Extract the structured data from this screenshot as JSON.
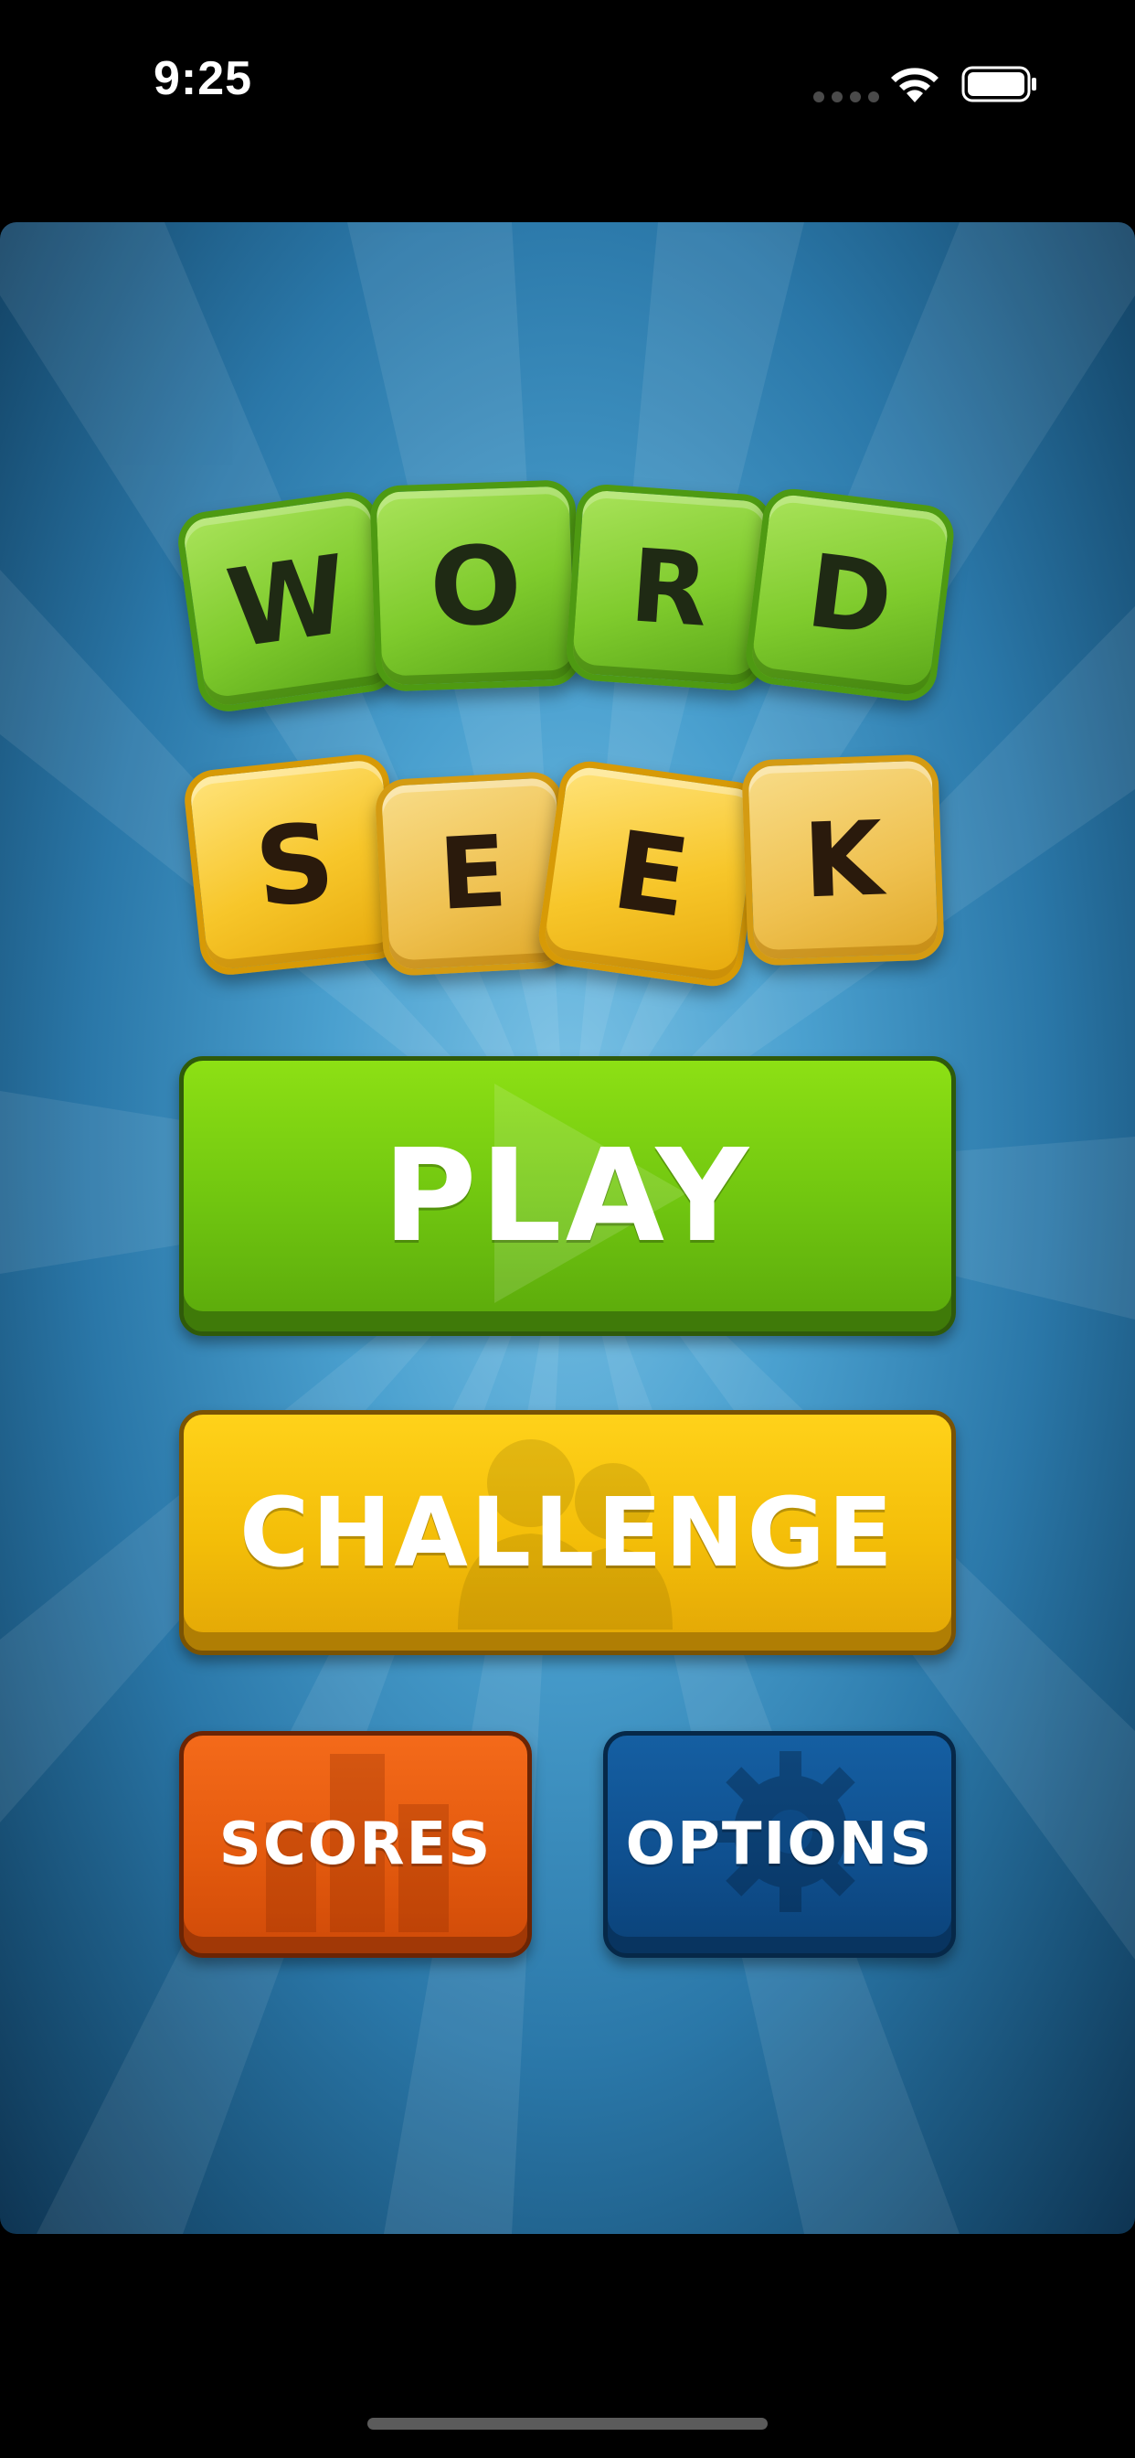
{
  "status_bar": {
    "time": "9:25",
    "icons": [
      "cellular-dots-icon",
      "wifi-icon",
      "battery-icon"
    ]
  },
  "logo": {
    "word1": [
      "W",
      "O",
      "R",
      "D"
    ],
    "word2": [
      "S",
      "E",
      "E",
      "K"
    ]
  },
  "menu": {
    "play_label": "PLAY",
    "challenge_label": "CHALLENGE",
    "scores_label": "SCORES",
    "options_label": "OPTIONS"
  },
  "colors": {
    "play": "#6fc410",
    "challenge": "#f3bd08",
    "scores": "#e45a0e",
    "options": "#0f5090",
    "tile_green": "#7fcb2d",
    "tile_yellow": "#f7c62a",
    "background": "#2a77a8"
  }
}
